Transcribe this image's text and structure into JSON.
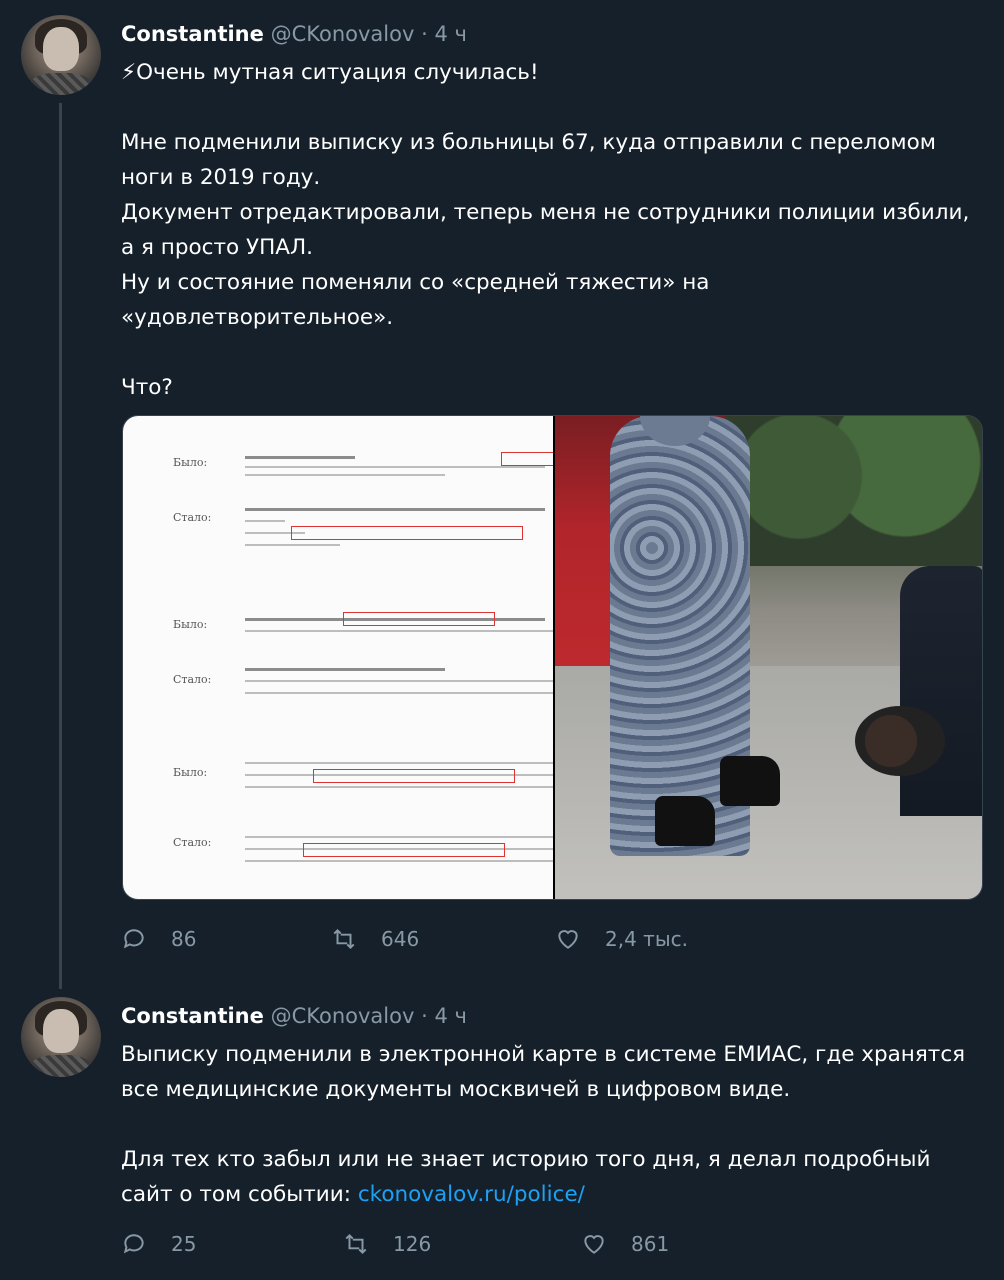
{
  "thread": [
    {
      "author": {
        "name": "Constantine",
        "handle": "@CKonovalov",
        "dot": "·",
        "time": "4 ч"
      },
      "text": "⚡Очень мутная ситуация случилась!\n\nМне подменили выписку из больницы 67, куда отправили с переломом ноги в 2019 году.\nДокумент отредактировали, теперь меня не сотрудники полиции избили, а я просто УПАЛ.\nНу и состояние поменяли со «средней тяжести» на «удовлетворительное».\n\nЧто?",
      "media": {
        "document_rows": [
          {
            "label": "Было:"
          },
          {
            "label": "Стало:"
          },
          {
            "label": "Было:"
          },
          {
            "label": "Стало:"
          },
          {
            "label": "Было:"
          },
          {
            "label": "Стало:"
          }
        ]
      },
      "stats": {
        "replies": "86",
        "retweets": "646",
        "likes": "2,4 тыс."
      }
    },
    {
      "author": {
        "name": "Constantine",
        "handle": "@CKonovalov",
        "dot": "·",
        "time": "4 ч"
      },
      "text": "Выписку подменили в электронной карте в системе ЕМИАС, где хранятся все медицинские документы москвичей в цифровом виде.\n\nДля тех кто забыл или не знает историю того дня, я делал подробный сайт о том событии: ",
      "link": "ckonovalov.ru/police/",
      "stats": {
        "replies": "25",
        "retweets": "126",
        "likes": "861"
      }
    }
  ],
  "colors": {
    "background": "#15202b",
    "secondary_text": "#8899a6",
    "link": "#1da1f2",
    "thread_line": "#38444d"
  },
  "icons": {
    "reply": "reply-icon",
    "retweet": "retweet-icon",
    "like": "heart-icon"
  }
}
